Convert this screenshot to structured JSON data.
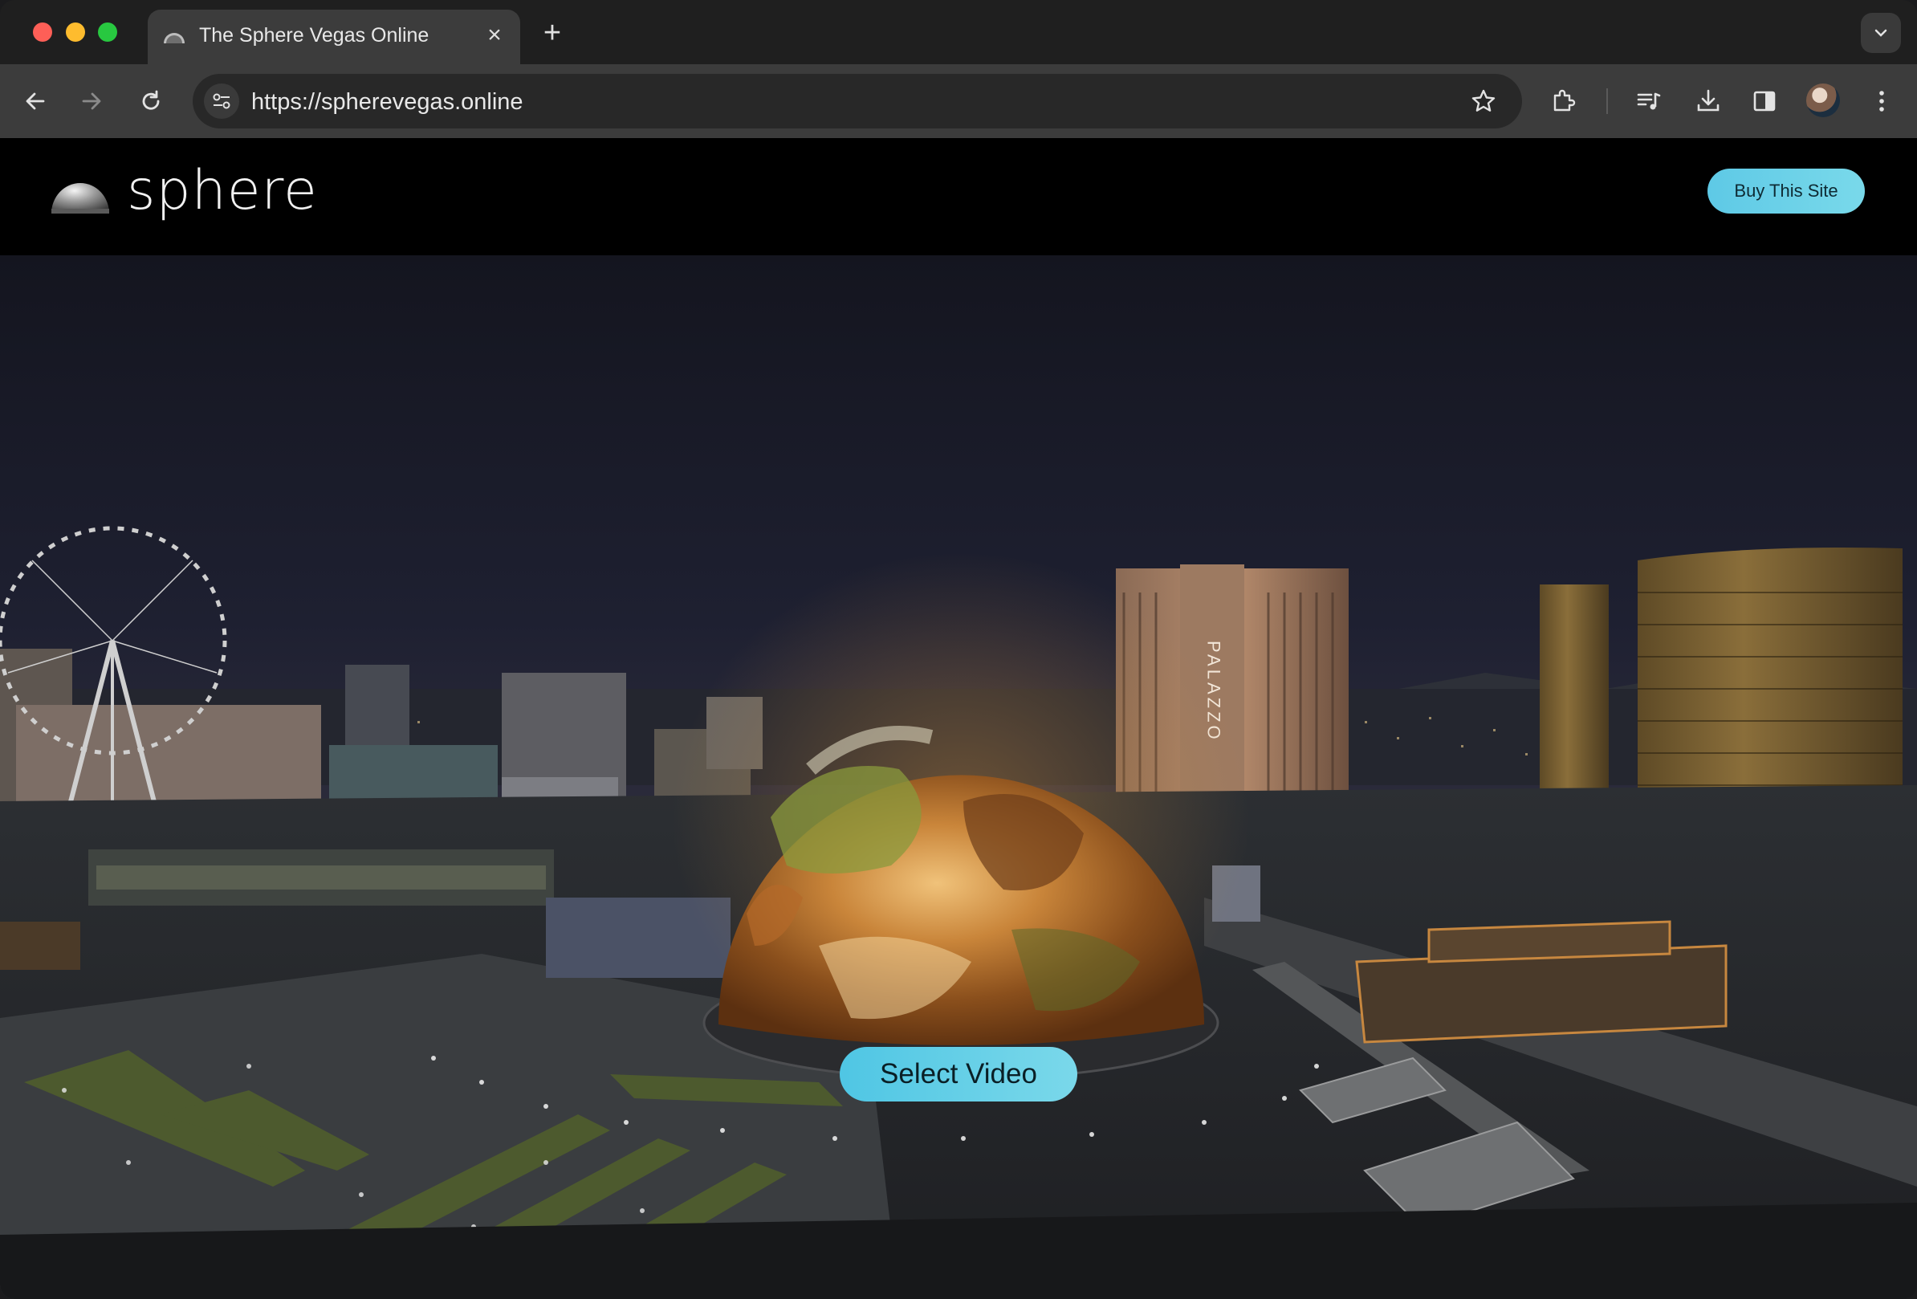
{
  "browser": {
    "tab": {
      "title": "The Sphere Vegas Online",
      "favicon": "sphere-dome-icon"
    },
    "url": "https://spherevegas.online",
    "icons": [
      "back-icon",
      "forward-icon",
      "reload-icon",
      "site-info-icon",
      "star-icon",
      "extensions-icon",
      "media-icon",
      "download-icon",
      "side-panel-icon",
      "avatar",
      "more-icon"
    ]
  },
  "site": {
    "logo_text": "sphere",
    "buy_button": "Buy This Site",
    "select_video_button": "Select Video",
    "hotel_sign": "PALAZZO"
  },
  "colors": {
    "button_accent": "#5ec9e6",
    "header_bg": "#000000",
    "sky": "#1b1d2e"
  }
}
